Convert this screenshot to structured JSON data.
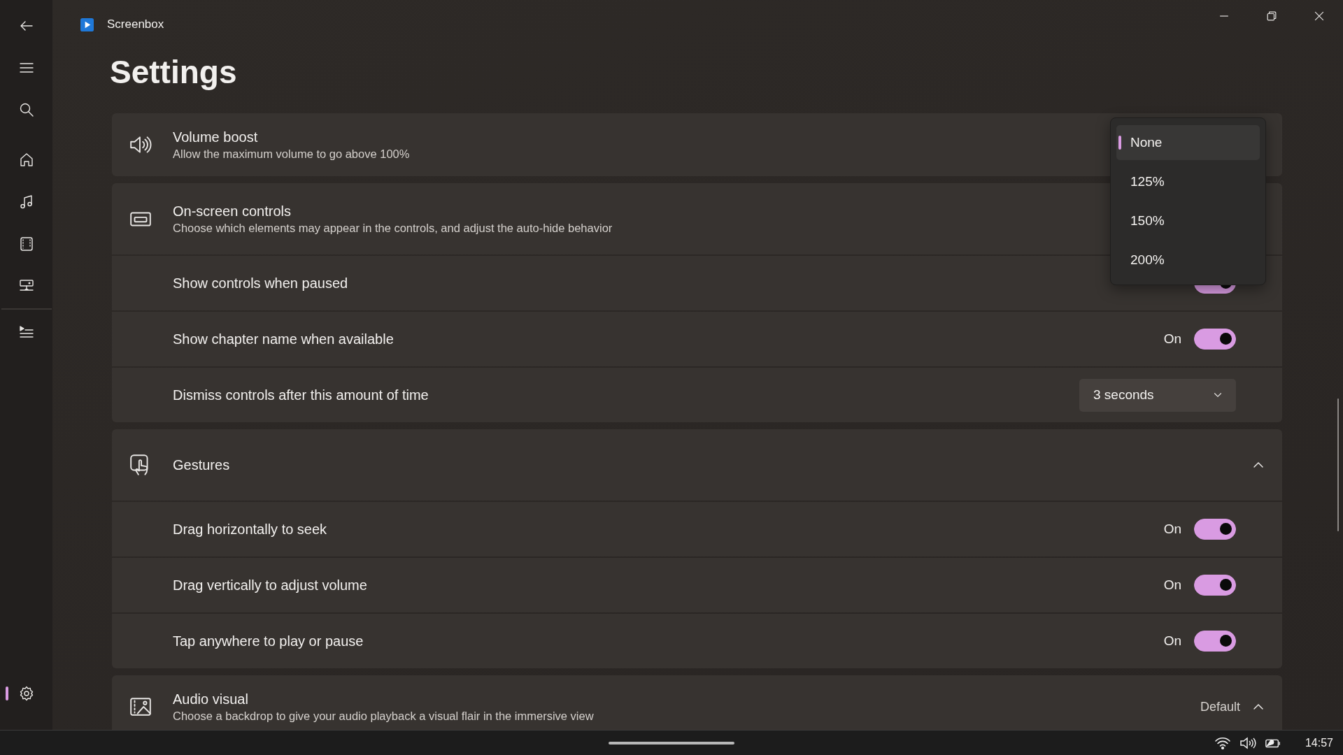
{
  "window": {
    "title": "Screenbox"
  },
  "nav": {
    "top": [
      {
        "kind": "back",
        "selected": false
      },
      {
        "kind": "menu",
        "selected": false
      },
      {
        "kind": "search",
        "selected": false
      },
      {
        "kind": "home",
        "selected": false
      },
      {
        "kind": "music",
        "selected": false
      },
      {
        "kind": "video",
        "selected": false
      },
      {
        "kind": "network",
        "selected": false
      },
      {
        "kind": "playlist",
        "selected": false
      }
    ],
    "bottom": [
      {
        "kind": "settings",
        "selected": true
      }
    ]
  },
  "page_title": "Settings",
  "sections": [
    {
      "kind": "volume",
      "title": "Volume boost",
      "subtitle": "Allow the maximum volume to go above 100%",
      "dropdown": {
        "options": [
          {
            "label": "None",
            "selected": true
          },
          {
            "label": "125%",
            "selected": false
          },
          {
            "label": "150%",
            "selected": false
          },
          {
            "label": "200%",
            "selected": false
          }
        ]
      }
    },
    {
      "kind": "controls",
      "title": "On-screen controls",
      "subtitle": "Choose which elements may appear in the controls, and adjust the auto-hide behavior",
      "rows": [
        {
          "kind": "toggle",
          "label": "Show controls when paused",
          "on": true
        },
        {
          "kind": "toggle",
          "label": "Show chapter name when available",
          "on": true,
          "state_text": "On"
        },
        {
          "kind": "combo",
          "label": "Dismiss controls after this amount of time",
          "value": "3 seconds"
        }
      ]
    },
    {
      "kind": "gestures",
      "title": "Gestures",
      "expanded": true,
      "rows": [
        {
          "kind": "toggle",
          "label": "Drag horizontally to seek",
          "on": true,
          "state_text": "On"
        },
        {
          "kind": "toggle",
          "label": "Drag vertically to adjust volume",
          "on": true,
          "state_text": "On"
        },
        {
          "kind": "toggle",
          "label": "Tap anywhere to play or pause",
          "on": true,
          "state_text": "On"
        }
      ]
    },
    {
      "kind": "visual",
      "title": "Audio visual",
      "subtitle": "Choose a backdrop to give your audio playback a visual flair in the immersive view",
      "value": "Default",
      "expanded": true
    }
  ],
  "taskbar": {
    "time": "14:57"
  }
}
